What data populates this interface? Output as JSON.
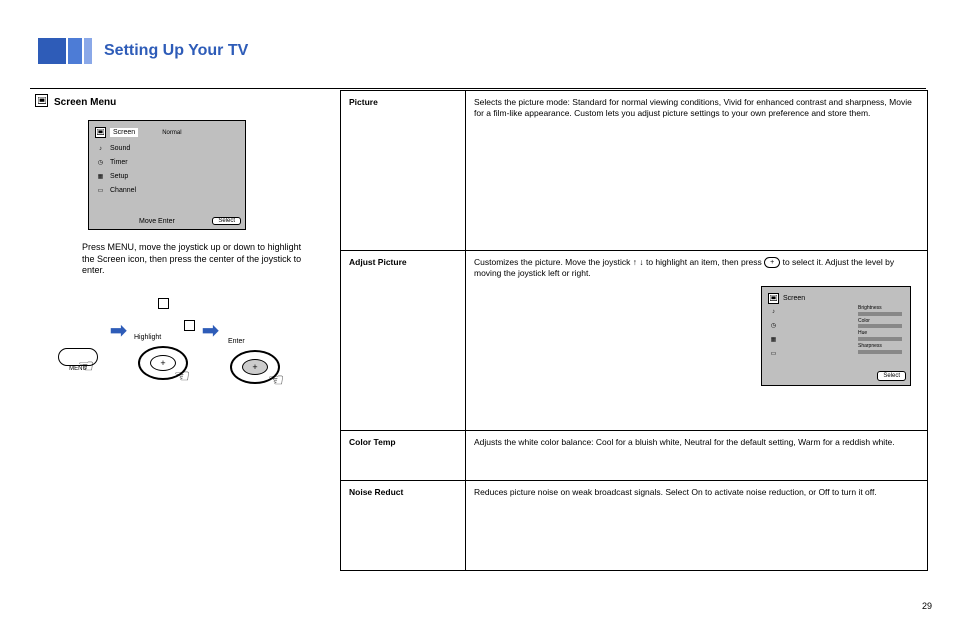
{
  "section_title": "Setting Up Your TV",
  "screen_menu_heading": "Screen Menu",
  "lcd1": {
    "rows": [
      {
        "icon": "screen",
        "label": "Screen",
        "sub": "Normal",
        "highlight": true
      },
      {
        "icon": "sound",
        "label": "Sound"
      },
      {
        "icon": "timer",
        "label": "Timer"
      },
      {
        "icon": "setup",
        "label": "Setup"
      },
      {
        "icon": "channel",
        "label": "Channel"
      }
    ],
    "select_label": "Select",
    "bottom_nav": "Move    Enter"
  },
  "instruction": "Press MENU, move the joystick up or down to highlight the Screen icon, then press the center of the joystick to enter.",
  "controls": {
    "menu_label": "MENU",
    "dpad_label_1": "Highlight",
    "dpad_label_2": "Enter"
  },
  "table": {
    "rows": [
      {
        "option": "Picture",
        "desc": "Selects the picture mode: Standard for normal viewing conditions, Vivid for enhanced contrast and sharpness, Movie for a film-like appearance. Custom lets you adjust picture settings to your own preference and store them."
      },
      {
        "option": "Adjust Picture",
        "desc_prefix": "Customizes the picture. Move the joystick ",
        "arrow_up": "↑",
        "arrow_down": "↓",
        "desc_mid": " to highlight an item, then press ",
        "enter_btn": "+",
        "desc_suffix": " to select it. Adjust the level by moving the joystick left or right.",
        "lcd2": {
          "rows": [
            {
              "icon": "screen",
              "label": "Screen",
              "highlight": true
            },
            {
              "icon": "sound",
              "label": "Sound"
            },
            {
              "icon": "timer",
              "label": "Timer"
            },
            {
              "icon": "setup",
              "label": "Setup"
            },
            {
              "icon": "channel",
              "label": "Channel"
            }
          ],
          "bars_labels": [
            "Brightness",
            "Color",
            "Hue",
            "Sharpness"
          ],
          "select_label": "Select"
        }
      },
      {
        "option": "Color Temp",
        "desc": "Adjusts the white color balance: Cool for a bluish white, Neutral for the default setting, Warm for a reddish white."
      },
      {
        "option": "Noise Reduct",
        "desc": "Reduces picture noise on weak broadcast signals. Select On to activate noise reduction, or Off to turn it off."
      }
    ]
  },
  "page_number": "29"
}
